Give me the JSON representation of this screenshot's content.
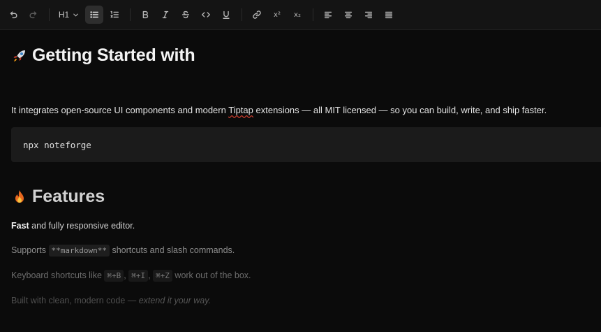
{
  "toolbar": {
    "heading_level": "H1",
    "superscript_label": "x²",
    "subscript_label": "x₂"
  },
  "doc": {
    "title": "Getting Started with",
    "intro_before": "It integrates open-source UI components and modern ",
    "intro_link": "Tiptap",
    "intro_after": " extensions — all MIT licensed — so you can build, write, and ship faster.",
    "code": "npx noteforge",
    "features_heading": "Features",
    "line1_bold": "Fast",
    "line1_rest": " and fully responsive editor.",
    "line2_before": "Supports ",
    "line2_code": "**markdown**",
    "line2_after": " shortcuts and slash commands.",
    "line3_before": "Keyboard shortcuts like ",
    "line3_k1": "⌘+B",
    "line3_sep1": ", ",
    "line3_k2": "⌘+I",
    "line3_sep2": ", ",
    "line3_k3": "⌘+Z",
    "line3_after": " work out of the box.",
    "line4_plain": "Built with clean, modern code — ",
    "line4_italic": "extend it your way."
  }
}
